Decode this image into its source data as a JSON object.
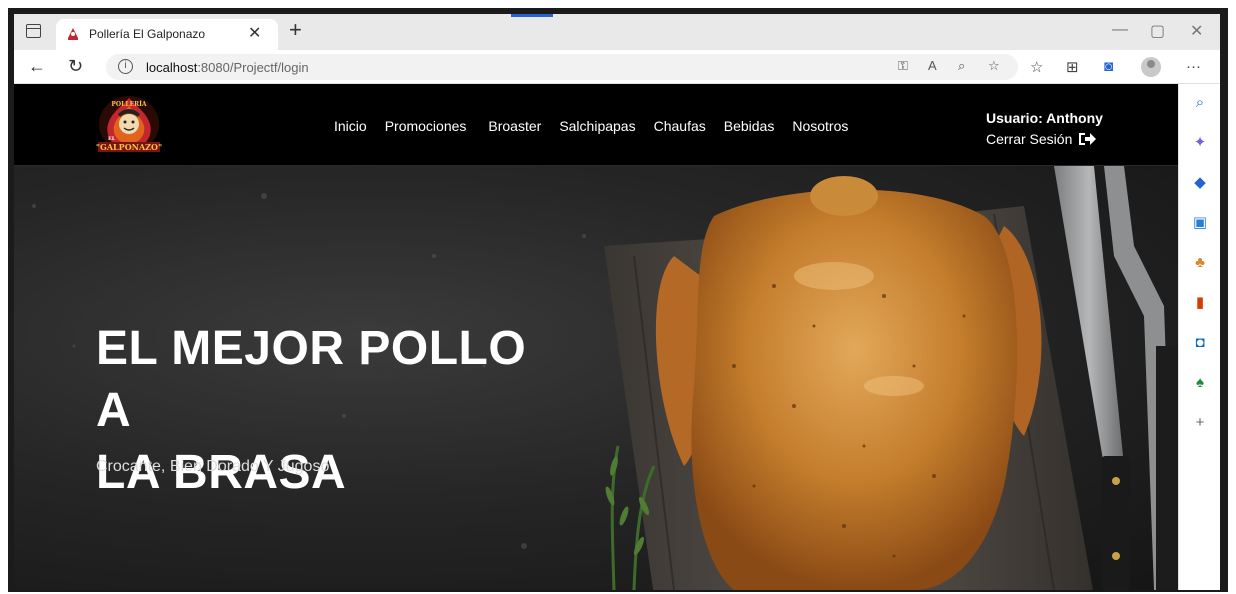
{
  "browser": {
    "tab_title": "Pollería El Galponazo",
    "tab_close": "✕",
    "new_tab": "+",
    "address_host": "localhost",
    "address_path": ":8080/Projectf/login",
    "window_controls": [
      "—",
      "▢",
      "✕"
    ]
  },
  "nav": {
    "logo_text_top": "POLLERÍA",
    "logo_text_el": "EL",
    "logo_text_name": "\"GALPONAZO\"",
    "links": [
      "Inicio",
      "Promociones",
      "Broaster",
      "Salchipapas",
      "Chaufas",
      "Bebidas",
      "Nosotros"
    ],
    "user_label": "Usuario: Anthony",
    "logout_label": "Cerrar Sesión"
  },
  "hero": {
    "title_line1": "EL MEJOR POLLO A",
    "title_line2": "LA BRASA",
    "subtitle": "Crocante, Bien Dorado Y Jugoso"
  },
  "colors": {
    "nav_bg": "#000000",
    "accent_red": "#c1272d",
    "chicken": "#c7842f"
  }
}
